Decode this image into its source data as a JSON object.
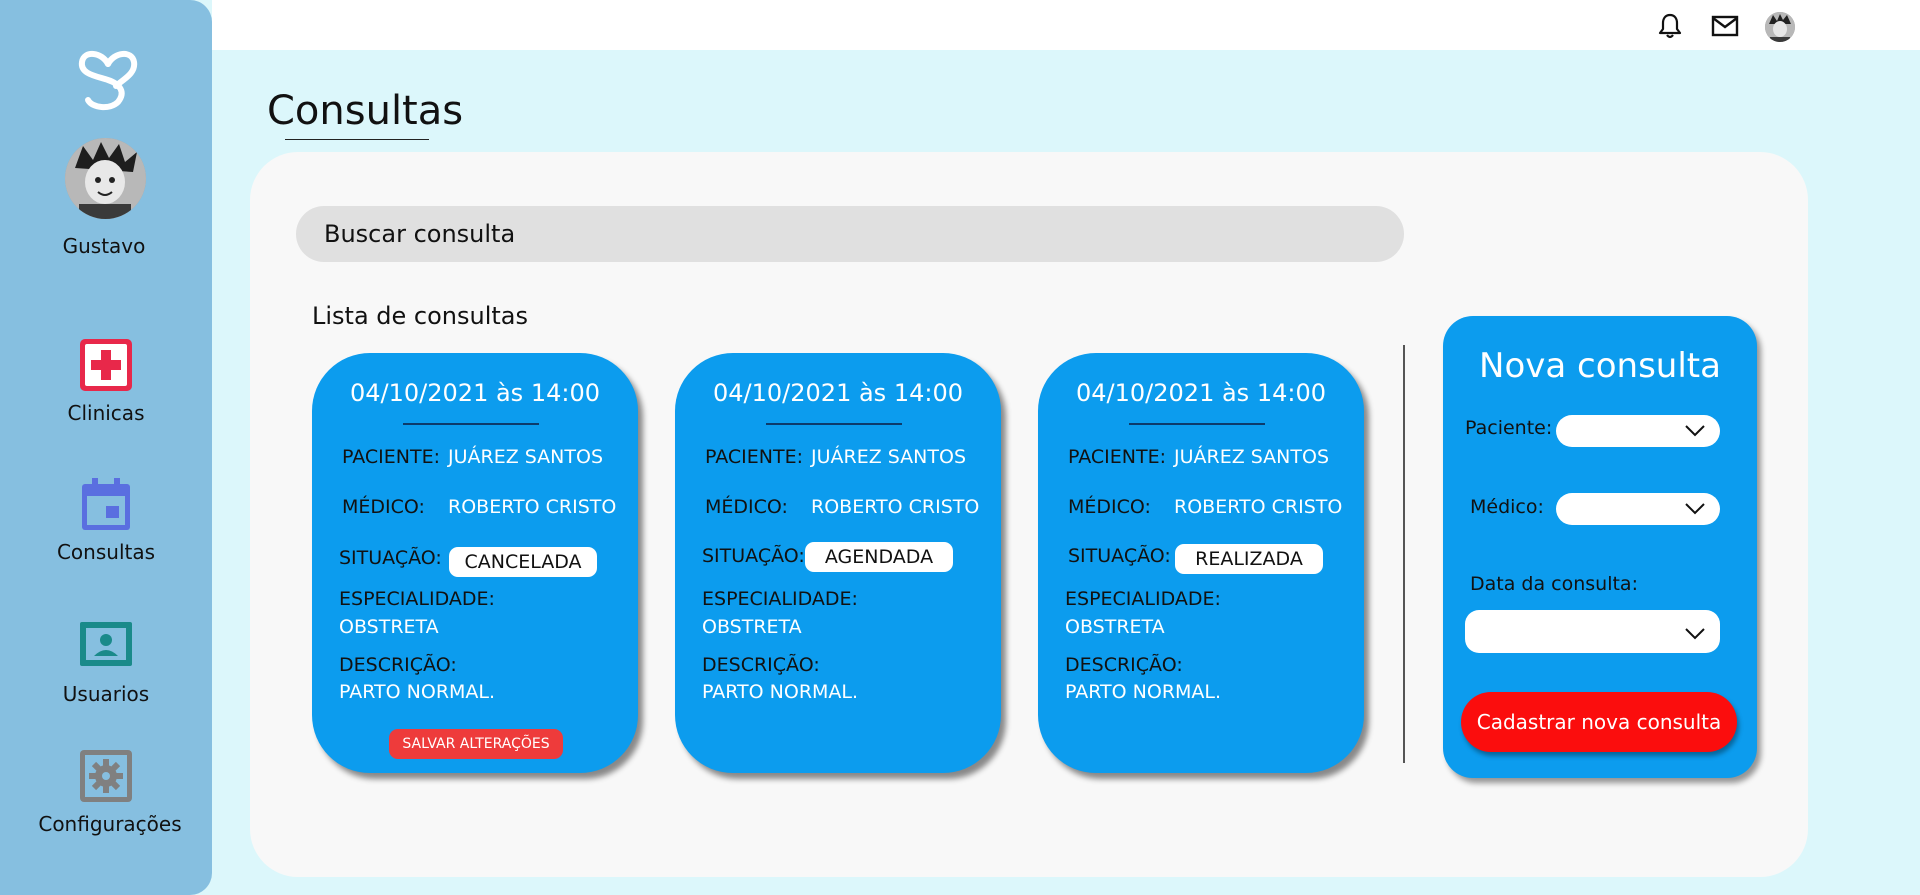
{
  "colors": {
    "sidebar": "#86bfe0",
    "page_bg": "#dcf7fb",
    "card": "#0c9cee",
    "save_button": "#ee3b3b",
    "submit_button": "#fb0d0d",
    "clinicas_icon": "#e8284a",
    "consultas_icon": "#5a6fe0",
    "usuarios_icon": "#1a8a8a",
    "config_icon": "#808080"
  },
  "sidebar": {
    "logo_icon": "heart-s-logo-icon",
    "user_name": "Gustavo",
    "items": [
      {
        "label": "Clinicas",
        "icon": "first-aid-icon"
      },
      {
        "label": "Consultas",
        "icon": "calendar-icon"
      },
      {
        "label": "Usuarios",
        "icon": "user-card-icon"
      },
      {
        "label": "Configurações",
        "icon": "gear-icon"
      }
    ]
  },
  "topbar": {
    "icons": [
      "bell-icon",
      "mail-icon",
      "avatar"
    ]
  },
  "main": {
    "title": "Consultas",
    "search_placeholder": "Buscar consulta",
    "list_title": "Lista de consultas",
    "cards": [
      {
        "date": "04/10/2021 às 14:00",
        "paciente_label": "PACIENTE:",
        "paciente": "JUÁREZ SANTOS",
        "medico_label": "MÉDICO:",
        "medico": "ROBERTO CRISTO",
        "situacao_label": "SITUAÇÃO:",
        "situacao": "CANCELADA",
        "especialidade_label": "ESPECIALIDADE:",
        "especialidade": "OBSTRETA",
        "descricao_label": "DESCRIÇÃO:",
        "descricao": "PARTO NORMAL.",
        "save_label": "SALVAR ALTERAÇÕES"
      },
      {
        "date": "04/10/2021 às 14:00",
        "paciente_label": "PACIENTE:",
        "paciente": "JUÁREZ SANTOS",
        "medico_label": "MÉDICO:",
        "medico": "ROBERTO CRISTO",
        "situacao_label": "SITUAÇÃO:",
        "situacao": "AGENDADA",
        "especialidade_label": "ESPECIALIDADE:",
        "especialidade": "OBSTRETA",
        "descricao_label": "DESCRIÇÃO:",
        "descricao": "PARTO NORMAL."
      },
      {
        "date": "04/10/2021 às 14:00",
        "paciente_label": "PACIENTE:",
        "paciente": "JUÁREZ SANTOS",
        "medico_label": "MÉDICO:",
        "medico": "ROBERTO CRISTO",
        "situacao_label": "SITUAÇÃO:",
        "situacao": "REALIZADA",
        "especialidade_label": "ESPECIALIDADE:",
        "especialidade": "OBSTRETA",
        "descricao_label": "DESCRIÇÃO:",
        "descricao": "PARTO NORMAL."
      }
    ]
  },
  "new_consultation": {
    "title": "Nova consulta",
    "paciente_label": "Paciente:",
    "paciente_value": "",
    "medico_label": "Médico:",
    "medico_value": "",
    "data_label": "Data da consulta:",
    "data_value": "",
    "submit_label": "Cadastrar nova consulta"
  }
}
